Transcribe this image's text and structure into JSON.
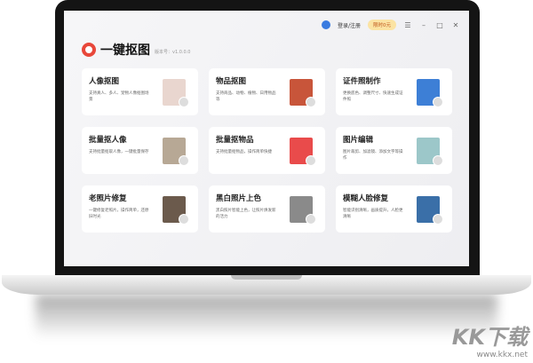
{
  "app": {
    "title": "一键抠图",
    "version": "版本号：v1.0.0.0"
  },
  "topbar": {
    "login": "登录/注册",
    "vip": "限时0元"
  },
  "cards": [
    {
      "title": "人像抠图",
      "desc": "支持真人、多人、宠物人像抠图场景",
      "color": "#e9d6cf"
    },
    {
      "title": "物品抠图",
      "desc": "支持商品、动物、植物、日用物品等",
      "color": "#c8553a"
    },
    {
      "title": "证件照制作",
      "desc": "更换底色、调整尺寸、快速生成证件照",
      "color": "#3d7fd6"
    },
    {
      "title": "批量抠人像",
      "desc": "支持批量抠取人像，一键批量保存",
      "color": "#b7a895"
    },
    {
      "title": "批量抠物品",
      "desc": "支持批量抠物品，操作简单快捷",
      "color": "#e94b4b"
    },
    {
      "title": "图片编辑",
      "desc": "图片裁剪、加滤镜、添加文字等操作",
      "color": "#9cc7c9"
    },
    {
      "title": "老照片修复",
      "desc": "一键修复老照片，操作简单，还原旧时光",
      "color": "#6b5a4c"
    },
    {
      "title": "黑白照片上色",
      "desc": "黑白照片智能上色，让照片焕发新的活力",
      "color": "#8a8a8a"
    },
    {
      "title": "模糊人脸修复",
      "desc": "智能识别清晰，画质提升，人脸更清晰",
      "color": "#3a6fa8"
    }
  ],
  "watermark": {
    "brand": "KK下载",
    "url": "www.kkx.net"
  }
}
